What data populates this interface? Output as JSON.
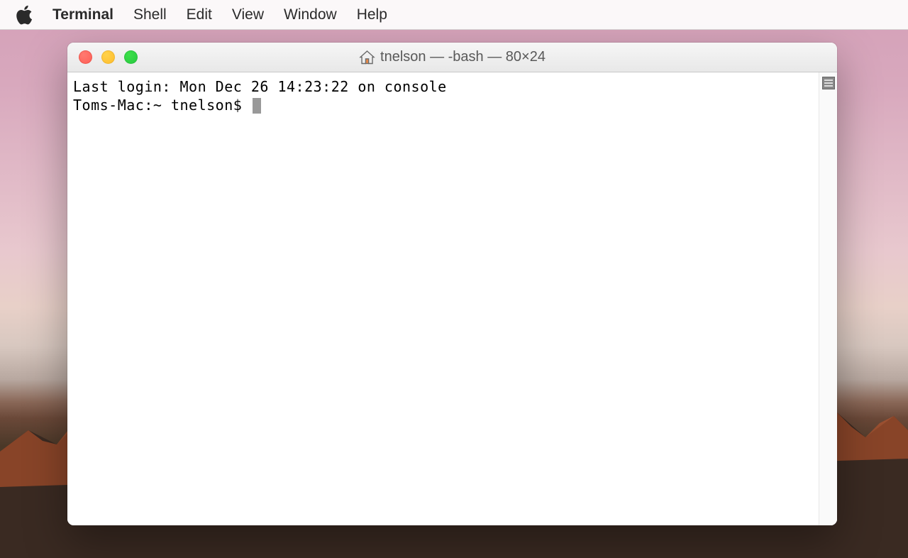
{
  "menubar": {
    "app_name": "Terminal",
    "items": [
      "Shell",
      "Edit",
      "View",
      "Window",
      "Help"
    ]
  },
  "window": {
    "title": "tnelson — -bash — 80×24"
  },
  "terminal": {
    "line1": "Last login: Mon Dec 26 14:23:22 on console",
    "prompt": "Toms-Mac:~ tnelson$ "
  }
}
